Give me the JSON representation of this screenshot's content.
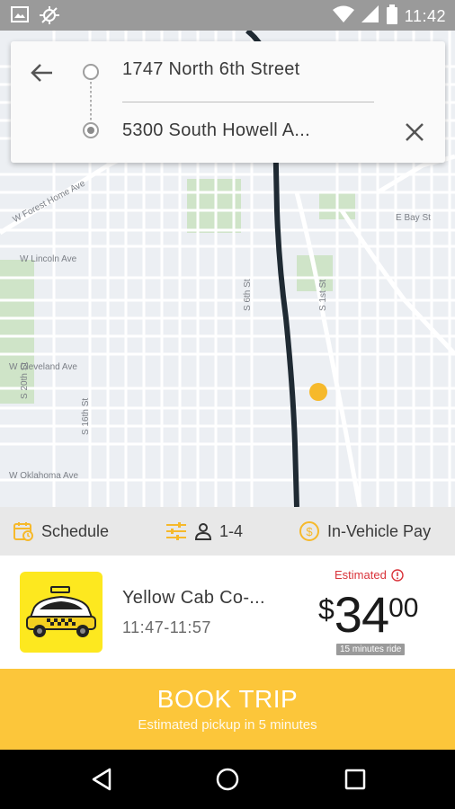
{
  "status_bar": {
    "time": "11:42",
    "icons": [
      "image-icon",
      "gps-off-icon",
      "wifi-icon",
      "cellular-signal-icon",
      "battery-icon"
    ]
  },
  "map": {
    "street_labels": [
      "W Forest Home Ave",
      "W Lincoln Ave",
      "W Cleveland Ave",
      "W Oklahoma Ave",
      "S 20th St",
      "S 16th St",
      "S 6th St",
      "S 1st St",
      "E Bay St"
    ],
    "route_color": "#1f2a33",
    "location_color": "#f6b92b"
  },
  "route": {
    "origin": "1747 North 6th Street",
    "destination": "5300 South Howell A..."
  },
  "options": {
    "schedule_label": "Schedule",
    "passengers_label": "1-4",
    "payment_label": "In-Vehicle Pay"
  },
  "trip": {
    "company": "Yellow Cab Co-...",
    "time_range": "11:47-11:57",
    "estimated_label": "Estimated",
    "price_currency": "$",
    "price_whole": "34",
    "price_cents": "00",
    "ride_duration": "15 minutes ride"
  },
  "book": {
    "title": "BOOK TRIP",
    "subtitle": "Estimated pickup in 5 minutes"
  },
  "colors": {
    "accent": "#fcc63a",
    "logo_bg": "#fde81f",
    "estimated_red": "#d9333a"
  }
}
